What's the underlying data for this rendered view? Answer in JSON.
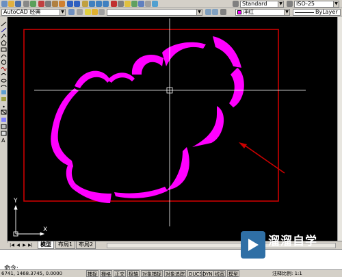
{
  "toolbar_top": {
    "text_style": "Standard",
    "dim_style": "ISO-25"
  },
  "toolbar_second": {
    "workspace": "AutoCAD 经典",
    "color_name": "洋红",
    "linetype": "ByLayer",
    "color_value": "#ff00ff"
  },
  "canvas": {
    "background": "#000000",
    "frame_color": "#cc0000",
    "cloud_color": "#ff00ff",
    "arrow_color": "#cc0000",
    "crosshair_color": "#ffffff",
    "ucs_y": "Y",
    "ucs_x": "X"
  },
  "tabs": [
    {
      "label": "模型",
      "active": true
    },
    {
      "label": "布局1",
      "active": false
    },
    {
      "label": "布局2",
      "active": false
    }
  ],
  "command": {
    "prompt": "命令:"
  },
  "status": {
    "coords": "6741, 1468.3745, 0.0000",
    "buttons": [
      "捕捉",
      "栅格",
      "正交",
      "极轴",
      "对象捕捉",
      "对象追踪",
      "DUCS",
      "DYN",
      "线宽",
      "模型"
    ],
    "scale_label": "注释比例: 1:1"
  },
  "watermark": {
    "title": "溜溜自学",
    "subtitle": "ZIXUE.3D66.COM"
  }
}
